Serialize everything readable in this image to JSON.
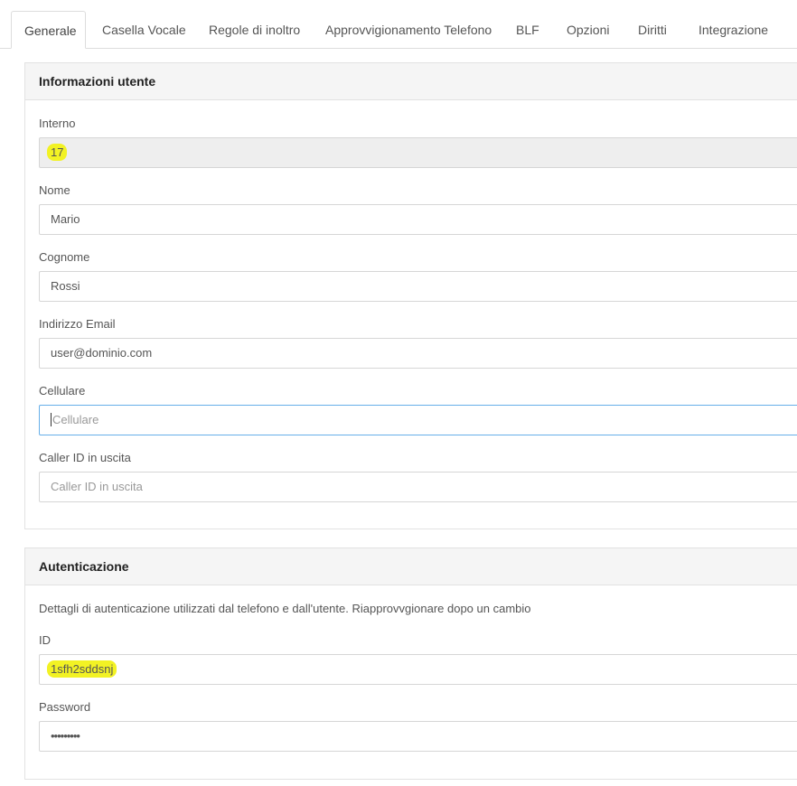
{
  "tabs": [
    {
      "label": "Generale",
      "active": true
    },
    {
      "label": "Casella Vocale"
    },
    {
      "label": "Regole di inoltro"
    },
    {
      "label": "Approvvigionamento Telefono"
    },
    {
      "label": "BLF"
    },
    {
      "label": "Opzioni"
    },
    {
      "label": "Diritti"
    },
    {
      "label": "Integrazione"
    }
  ],
  "user_info": {
    "title": "Informazioni utente",
    "extension": {
      "label": "Interno",
      "value": "17"
    },
    "first_name": {
      "label": "Nome",
      "value": "Mario"
    },
    "last_name": {
      "label": "Cognome",
      "value": "Rossi"
    },
    "email": {
      "label": "Indirizzo Email",
      "value": "user@dominio.com"
    },
    "mobile": {
      "label": "Cellulare",
      "placeholder": "Cellulare"
    },
    "caller_id": {
      "label": "Caller ID in uscita",
      "placeholder": "Caller ID in uscita"
    }
  },
  "auth": {
    "title": "Autenticazione",
    "description": "Dettagli di autenticazione utilizzati dal telefono e dall'utente. Riapprovvgionare dopo un cambio",
    "id": {
      "label": "ID",
      "value": "1sfh2sddsnj"
    },
    "password": {
      "label": "Password",
      "value": "•••••••••"
    }
  },
  "colors": {
    "highlight": "#f2f224",
    "focus_border": "#66afe9",
    "panel_header": "#f5f5f5"
  }
}
